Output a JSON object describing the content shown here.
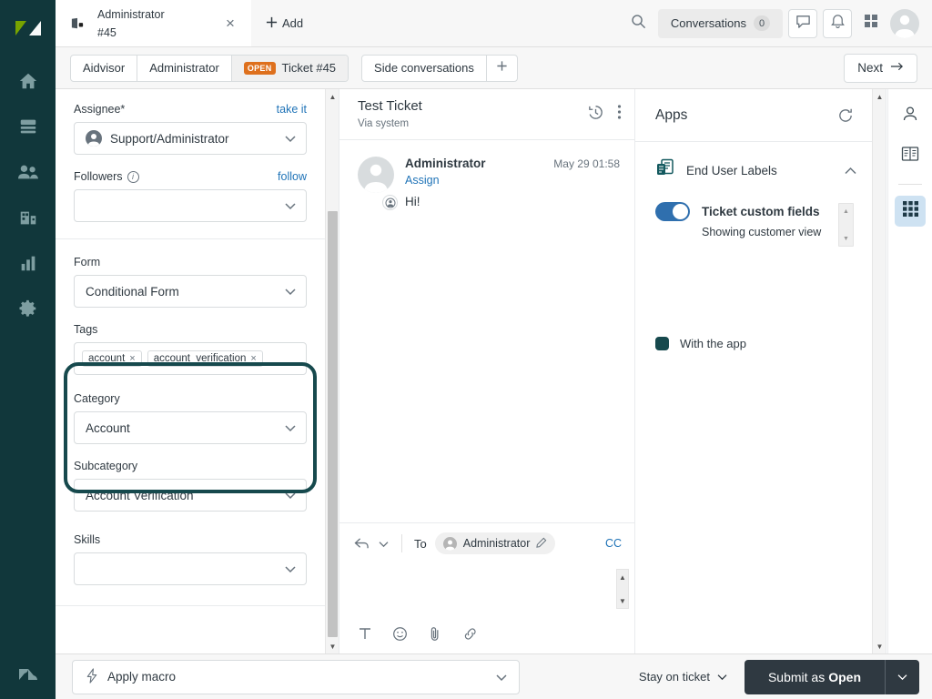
{
  "left_rail": {
    "brand_icon": "zendesk-logo",
    "items": [
      {
        "icon": "home-icon",
        "name": "home"
      },
      {
        "icon": "views-icon",
        "name": "views"
      },
      {
        "icon": "customers-icon",
        "name": "customers"
      },
      {
        "icon": "organizations-icon",
        "name": "organizations"
      },
      {
        "icon": "reporting-icon",
        "name": "reporting"
      },
      {
        "icon": "gear-icon",
        "name": "admin"
      }
    ],
    "footer_icon": "zendesk-mark"
  },
  "topbar": {
    "tab": {
      "title": "Administrator",
      "subtitle": "#45",
      "icon": "ticket-icon",
      "close": "×"
    },
    "add_label": "Add",
    "add_icon": "plus-icon",
    "search_icon": "search-icon",
    "conversations_label": "Conversations",
    "conversations_count": "0",
    "chat_icon": "chat-icon",
    "bell_icon": "bell-icon",
    "grid_icon": "apps-grid-icon",
    "avatar": "user-avatar"
  },
  "subnav": {
    "breadcrumbs": [
      {
        "label": "Aidvisor",
        "badge": null,
        "active": false
      },
      {
        "label": "Administrator",
        "badge": null,
        "active": false
      },
      {
        "label": "Ticket #45",
        "badge": "OPEN",
        "active": true
      }
    ],
    "side_conversations_label": "Side conversations",
    "plus_icon": "plus-icon",
    "next_label": "Next",
    "next_icon": "arrow-right-icon"
  },
  "properties": {
    "assignee": {
      "label": "Assignee*",
      "action": "take it",
      "value": "Support/Administrator",
      "avatar": "agent-avatar"
    },
    "followers": {
      "label": "Followers",
      "info_icon": "info-icon",
      "action": "follow",
      "value": ""
    },
    "form": {
      "label": "Form",
      "value": "Conditional Form"
    },
    "tags": {
      "label": "Tags",
      "chips": [
        {
          "text": "account",
          "remove": "×"
        },
        {
          "text": "account_verification",
          "remove": "×"
        }
      ]
    },
    "category": {
      "label": "Category",
      "value": "Account"
    },
    "subcategory": {
      "label": "Subcategory",
      "value": "Account Verification"
    },
    "skills": {
      "label": "Skills",
      "value": ""
    },
    "highlight_color": "#16494d"
  },
  "conversation": {
    "title": "Test Ticket",
    "via": "Via system",
    "history_icon": "history-icon",
    "more_icon": "more-vertical-icon",
    "comments": [
      {
        "author": "Administrator",
        "timestamp": "May 29 01:58",
        "assign_label": "Assign",
        "body": "Hi!",
        "avatar": "user-avatar",
        "badge_icon": "agent-badge-icon"
      }
    ],
    "composer": {
      "reply_icon": "reply-icon",
      "chevron_icon": "chevron-down-icon",
      "to_label": "To",
      "recipient": "Administrator",
      "edit_icon": "pencil-icon",
      "cc_label": "CC",
      "tools": [
        {
          "icon": "text-format-icon",
          "glyph": "T"
        },
        {
          "icon": "emoji-icon",
          "glyph": "☺"
        },
        {
          "icon": "attachment-icon",
          "glyph": "📎"
        },
        {
          "icon": "link-icon",
          "glyph": "🔗"
        }
      ]
    }
  },
  "apps_panel": {
    "title": "Apps",
    "refresh_icon": "refresh-icon",
    "app": {
      "icon": "end-user-labels-icon",
      "name": "End User Labels",
      "collapse_icon": "chevron-up-icon",
      "toggle_label": "Ticket custom fields",
      "toggle_on": true,
      "toggle_color": "#2f6fae",
      "note": "Showing customer view"
    },
    "with_app_label": "With the app",
    "with_app_color": "#16494d"
  },
  "right_rail": {
    "items": [
      {
        "icon": "user-icon",
        "name": "user-panel",
        "active": false
      },
      {
        "icon": "knowledge-icon",
        "name": "knowledge-panel",
        "active": false
      },
      {
        "icon": "apps-grid-icon",
        "name": "apps-panel",
        "active": true
      }
    ]
  },
  "bottom": {
    "macro_label": "Apply macro",
    "macro_icon": "lightning-icon",
    "stay_label": "Stay on ticket",
    "submit_prefix": "Submit as",
    "submit_status": "Open",
    "submit_color": "#2f3941"
  }
}
